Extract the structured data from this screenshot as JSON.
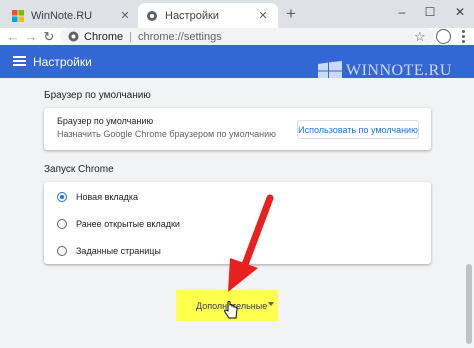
{
  "tabs": [
    {
      "title": "WinNote.RU",
      "icon": "windows-logo-icon"
    },
    {
      "title": "Настройки",
      "icon": "settings-gear-icon"
    }
  ],
  "toolbar": {
    "origin_label": "Chrome",
    "url": "chrome://settings"
  },
  "header": {
    "title": "Настройки"
  },
  "watermark": "WINNOTE.RU",
  "default_browser": {
    "section_title": "Браузер по умолчанию",
    "row_title": "Браузер по умолчанию",
    "row_subtitle": "Назначить Google Chrome браузером по умолчанию",
    "button_label": "Использовать по умолчанию"
  },
  "startup": {
    "section_title": "Запуск Chrome",
    "options": [
      {
        "label": "Новая вкладка",
        "selected": true
      },
      {
        "label": "Ранее открытые вкладки",
        "selected": false
      },
      {
        "label": "Заданные страницы",
        "selected": false
      }
    ]
  },
  "advanced": {
    "label": "Дополнительные",
    "highlight_color": "#ffff4d"
  },
  "colors": {
    "header": "#3367d6",
    "accent": "#1a73e8",
    "annotation_arrow": "#e8211e"
  }
}
